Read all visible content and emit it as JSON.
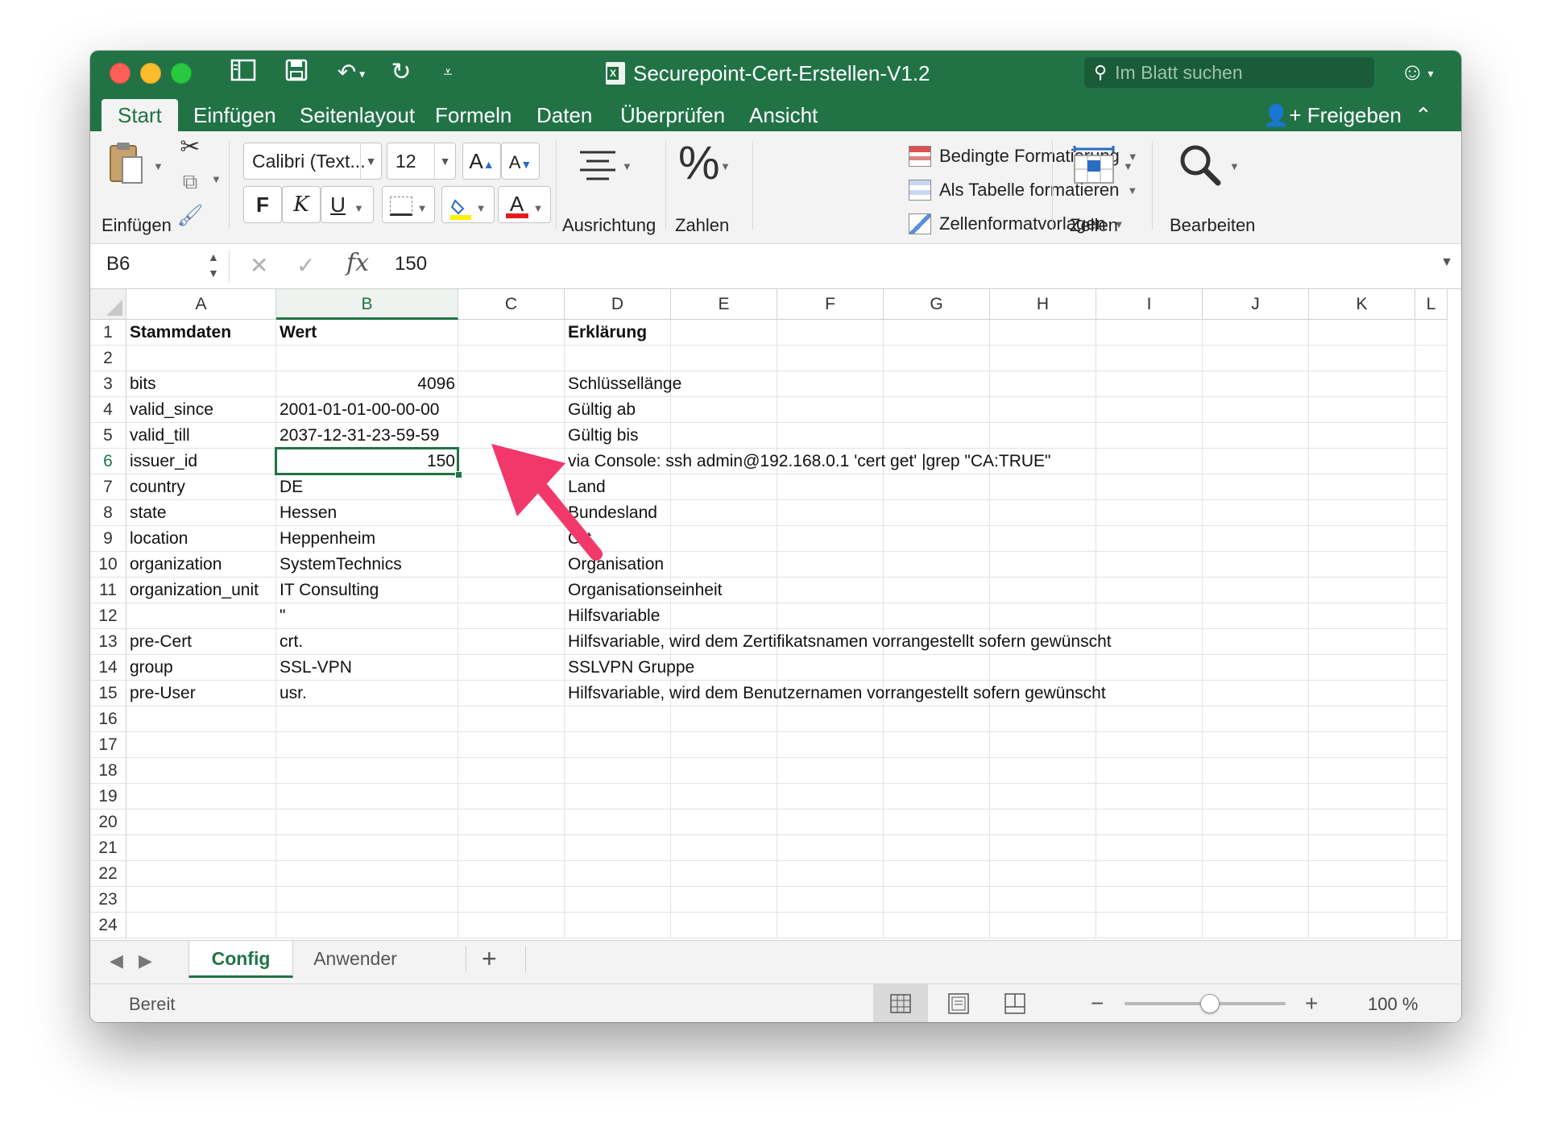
{
  "titlebar": {
    "title": "Securepoint-Cert-Erstellen-V1.2",
    "search_placeholder": "Im Blatt suchen"
  },
  "tabs": [
    "Start",
    "Einfügen",
    "Seitenlayout",
    "Formeln",
    "Daten",
    "Überprüfen",
    "Ansicht"
  ],
  "active_tab": "Start",
  "share_label": "Freigeben",
  "ribbon": {
    "paste_label": "Einfügen",
    "font_name": "Calibri (Text...",
    "font_size": "12",
    "grow_font": "A",
    "shrink_font": "A",
    "bold": "F",
    "italic": "K",
    "underline": "U",
    "font_color_letter": "A",
    "alignment_label": "Ausrichtung",
    "number_label": "Zahlen",
    "conditional_formatting": "Bedingte Formatierung",
    "format_as_table": "Als Tabelle formatieren",
    "cell_styles": "Zellenformatvorlagen",
    "cells_label": "Zellen",
    "editing_label": "Bearbeiten"
  },
  "formula_bar": {
    "name_box": "B6",
    "fx": "fx",
    "value": "150"
  },
  "columns": [
    "A",
    "B",
    "C",
    "D",
    "E",
    "F",
    "G",
    "H",
    "I",
    "J",
    "K",
    "L"
  ],
  "selected_column": "B",
  "selected_row": "6",
  "rows": [
    {
      "n": "1",
      "a": "Stammdaten",
      "b": "Wert",
      "d": "Erklärung"
    },
    {
      "n": "2",
      "a": "",
      "b": "",
      "d": ""
    },
    {
      "n": "3",
      "a": "bits",
      "b": "4096",
      "d": "Schlüssellänge"
    },
    {
      "n": "4",
      "a": "valid_since",
      "b": "2001-01-01-00-00-00",
      "d": "Gültig ab"
    },
    {
      "n": "5",
      "a": "valid_till",
      "b": "2037-12-31-23-59-59",
      "d": "Gültig bis"
    },
    {
      "n": "6",
      "a": "issuer_id",
      "b": "150",
      "d": "via Console: ssh admin@192.168.0.1 'cert get' |grep \"CA:TRUE\""
    },
    {
      "n": "7",
      "a": "country",
      "b": "DE",
      "d": "Land"
    },
    {
      "n": "8",
      "a": "state",
      "b": "Hessen",
      "d": "Bundesland"
    },
    {
      "n": "9",
      "a": "location",
      "b": "Heppenheim",
      "d": "Ort"
    },
    {
      "n": "10",
      "a": "organization",
      "b": "SystemTechnics",
      "d": "Organisation"
    },
    {
      "n": "11",
      "a": "organization_unit",
      "b": "IT Consulting",
      "d": "Organisationseinheit"
    },
    {
      "n": "12",
      "a": "",
      "b": "\"",
      "d": "Hilfsvariable"
    },
    {
      "n": "13",
      "a": "pre-Cert",
      "b": "crt.",
      "d": "Hilfsvariable, wird dem Zertifikatsnamen vorrangestellt sofern gewünscht"
    },
    {
      "n": "14",
      "a": "group",
      "b": "SSL-VPN",
      "d": "SSLVPN Gruppe"
    },
    {
      "n": "15",
      "a": "pre-User",
      "b": "usr.",
      "d": "Hilfsvariable, wird dem Benutzernamen vorrangestellt sofern gewünscht"
    },
    {
      "n": "16",
      "a": "",
      "b": "",
      "d": ""
    },
    {
      "n": "17",
      "a": "",
      "b": "",
      "d": ""
    },
    {
      "n": "18",
      "a": "",
      "b": "",
      "d": ""
    },
    {
      "n": "19",
      "a": "",
      "b": "",
      "d": ""
    },
    {
      "n": "20",
      "a": "",
      "b": "",
      "d": ""
    },
    {
      "n": "21",
      "a": "",
      "b": "",
      "d": ""
    },
    {
      "n": "22",
      "a": "",
      "b": "",
      "d": ""
    },
    {
      "n": "23",
      "a": "",
      "b": "",
      "d": ""
    },
    {
      "n": "24",
      "a": "",
      "b": "",
      "d": ""
    }
  ],
  "sheets": [
    "Config",
    "Anwender"
  ],
  "active_sheet": "Config",
  "status": {
    "text": "Bereit",
    "zoom": "100 %",
    "zoom_minus": "−",
    "zoom_plus": "+"
  },
  "colors": {
    "excel_green": "#217346",
    "annotation_arrow": "#f2386b"
  }
}
